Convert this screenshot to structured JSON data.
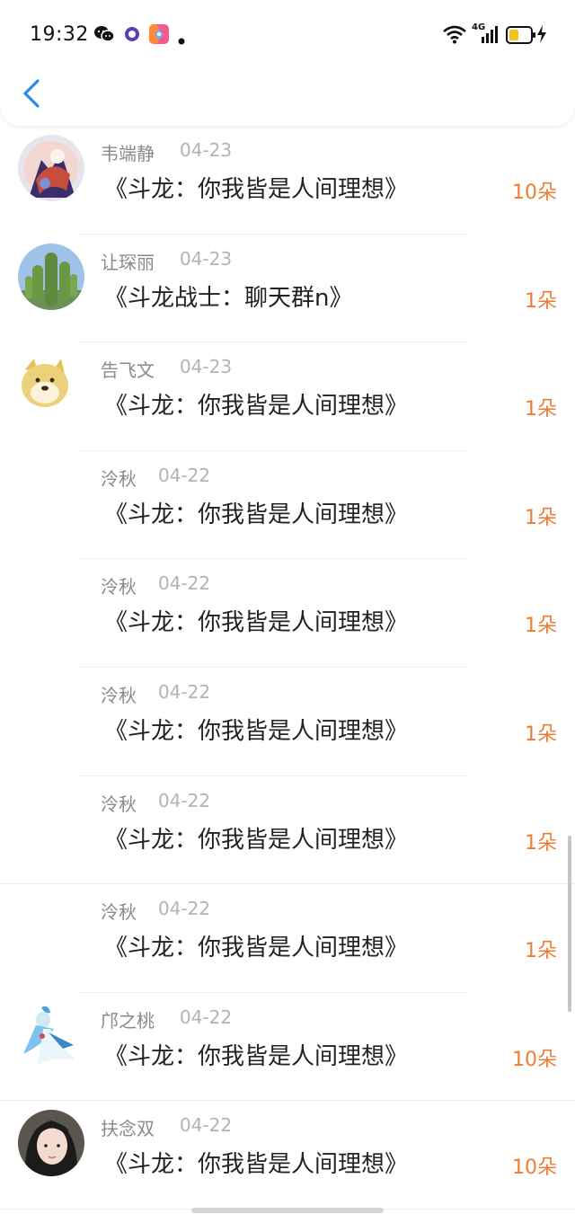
{
  "status_bar": {
    "time": "19:32",
    "network": "4G",
    "icons": [
      "wechat-icon",
      "record-icon",
      "app-icon",
      "dot-icon",
      "wifi-icon",
      "signal-icon",
      "battery-icon",
      "charging-icon"
    ]
  },
  "header": {
    "back_icon": "chevron-left-icon",
    "accent": "#2a8ae6"
  },
  "colors": {
    "amount": "#ef7c33",
    "name": "#8a8a8a",
    "date": "#b3b3b3",
    "title": "#222222"
  },
  "records": [
    {
      "name": "韦端静",
      "date": "04-23",
      "title": "《斗龙：你我皆是人间理想》",
      "amount": "10朵",
      "avatar": "anime-avatar"
    },
    {
      "name": "让琛丽",
      "date": "04-23",
      "title": "《斗龙战士：聊天群n》",
      "amount": "1朵",
      "avatar": "cactus-avatar"
    },
    {
      "name": "告飞文",
      "date": "04-23",
      "title": "《斗龙：你我皆是人间理想》",
      "amount": "1朵",
      "avatar": "doge-avatar"
    },
    {
      "name": "泠秋",
      "date": "04-22",
      "title": "《斗龙：你我皆是人间理想》",
      "amount": "1朵",
      "avatar": "none"
    },
    {
      "name": "泠秋",
      "date": "04-22",
      "title": "《斗龙：你我皆是人间理想》",
      "amount": "1朵",
      "avatar": "none"
    },
    {
      "name": "泠秋",
      "date": "04-22",
      "title": "《斗龙：你我皆是人间理想》",
      "amount": "1朵",
      "avatar": "none"
    },
    {
      "name": "泠秋",
      "date": "04-22",
      "title": "《斗龙：你我皆是人间理想》",
      "amount": "1朵",
      "avatar": "none"
    },
    {
      "name": "泠秋",
      "date": "04-22",
      "title": "《斗龙：你我皆是人间理想》",
      "amount": "1朵",
      "avatar": "none"
    },
    {
      "name": "邝之桃",
      "date": "04-22",
      "title": "《斗龙：你我皆是人间理想》",
      "amount": "10朵",
      "avatar": "gardevoir-avatar"
    },
    {
      "name": "扶念双",
      "date": "04-22",
      "title": "《斗龙：你我皆是人间理想》",
      "amount": "10朵",
      "avatar": "girl-avatar"
    }
  ]
}
